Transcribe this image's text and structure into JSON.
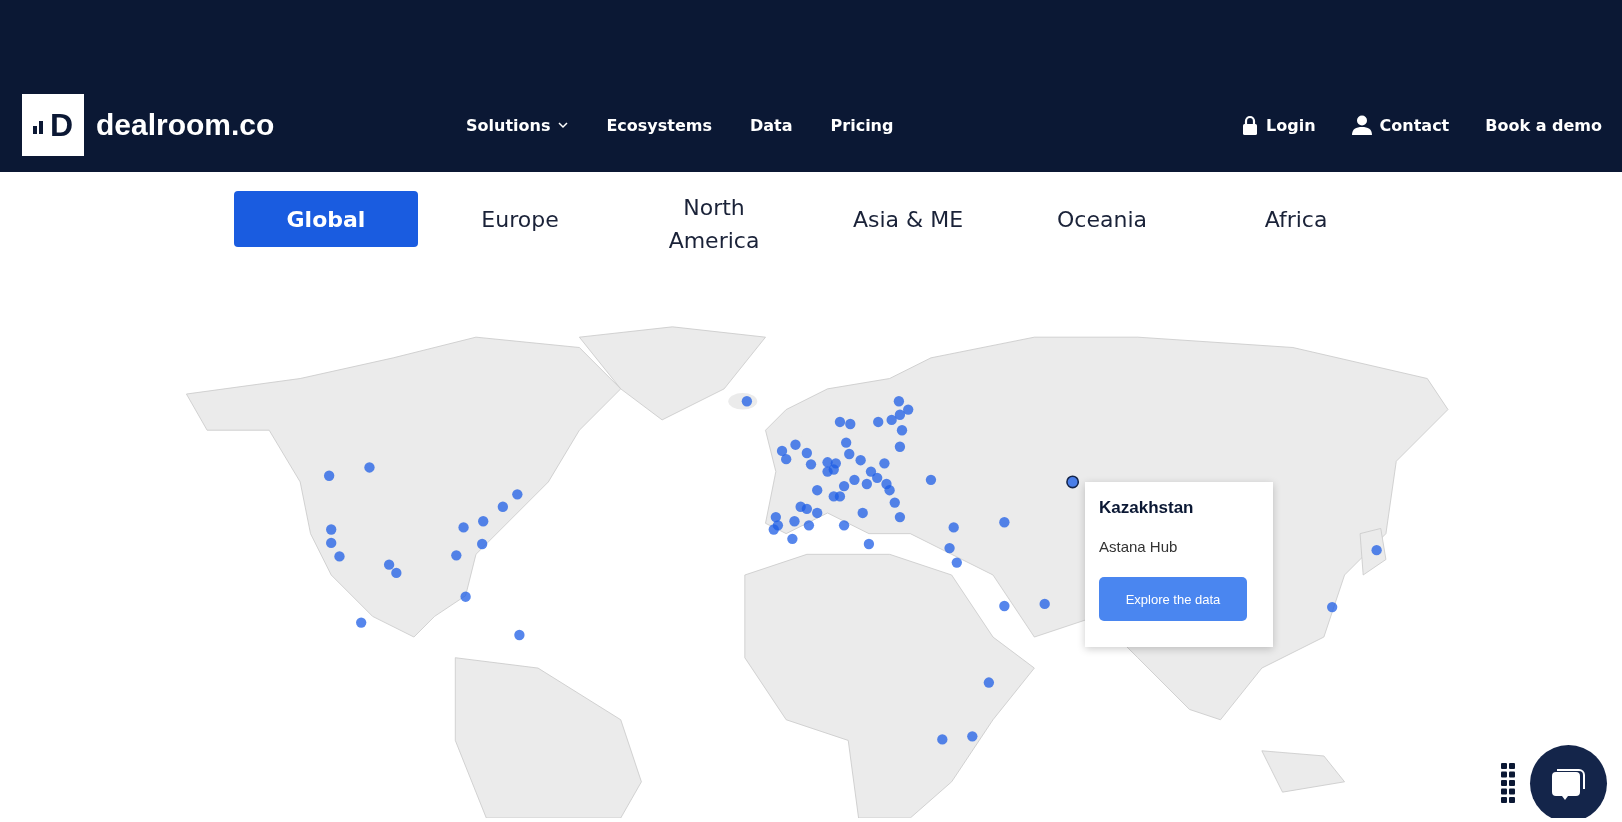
{
  "header": {
    "logo_mark": "D",
    "logo_text": "dealroom.co",
    "nav": [
      {
        "label": "Solutions",
        "kind": "dropdown"
      },
      {
        "label": "Ecosystems",
        "kind": "link"
      },
      {
        "label": "Data",
        "kind": "link"
      },
      {
        "label": "Pricing",
        "kind": "link"
      }
    ],
    "actions": [
      {
        "label": "Login",
        "kind": "lock"
      },
      {
        "label": "Contact",
        "kind": "person"
      },
      {
        "label": "Book a demo",
        "kind": "plain"
      }
    ]
  },
  "region_tabs": [
    {
      "label": "Global",
      "selected": true
    },
    {
      "label": "Europe",
      "selected": false
    },
    {
      "label": "North America",
      "selected": false
    },
    {
      "label": "Asia & ME",
      "selected": false
    },
    {
      "label": "Oceania",
      "selected": false
    },
    {
      "label": "Africa",
      "selected": false
    }
  ],
  "tooltip": {
    "country": "Kazakhstan",
    "hub": "Astana Hub",
    "button": "Explore the data"
  }
}
